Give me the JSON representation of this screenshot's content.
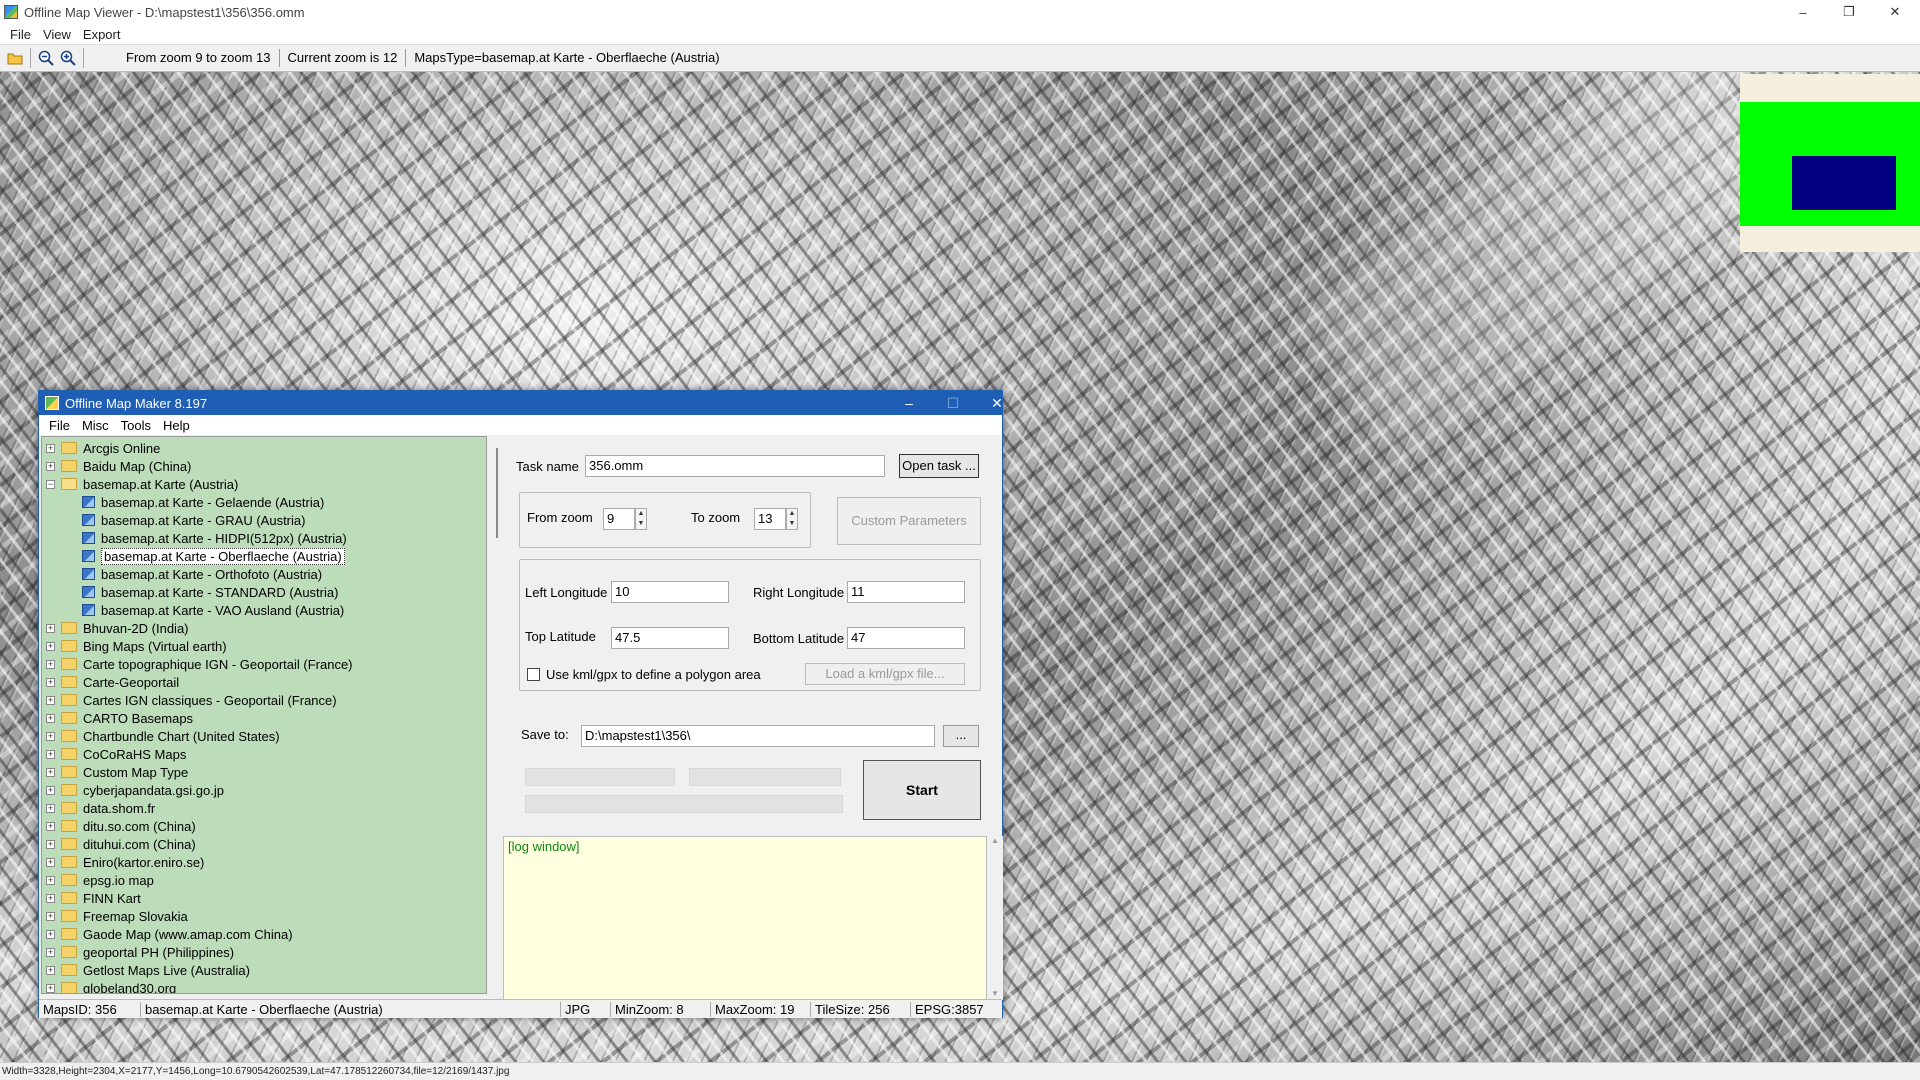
{
  "window": {
    "title": "Offline Map Viewer - D:\\mapstest1\\356\\356.omm",
    "controls": {
      "minimize": "–",
      "maximize": "❐",
      "close": "✕"
    }
  },
  "menu": [
    "File",
    "View",
    "Export"
  ],
  "toolbar": {
    "icons": [
      "open-folder-icon",
      "zoom-out-icon",
      "zoom-in-icon"
    ],
    "zoom_range": "From zoom 9 to zoom 13",
    "current_zoom": "Current zoom is 12",
    "maps_type": "MapsType=basemap.at Karte - Oberflaeche (Austria)"
  },
  "colors": {
    "minimap_bg": "#f5efe0",
    "minimap_green": "#00ff00",
    "minimap_view": "#000080",
    "tree_bg": "#bddcba",
    "dialog_title": "#1e5eb5",
    "log_bg": "#ffffe0",
    "log_text": "#118811"
  },
  "statusbar": "Width=3328,Height=2304,X=2177,Y=1456,Long=10.6790542602539,Lat=47.178512260734,file=12/2169/1437.jpg",
  "dialog": {
    "title": "Offline Map Maker 8.197",
    "controls": {
      "minimize": "–",
      "maximize": "☐",
      "close": "✕"
    },
    "menu": [
      "File",
      "Misc",
      "Tools",
      "Help"
    ],
    "tree": [
      {
        "label": "Arcgis Online",
        "type": "folder",
        "expander": "+"
      },
      {
        "label": "Baidu Map (China)",
        "type": "folder",
        "expander": "+"
      },
      {
        "label": "basemap.at Karte (Austria)",
        "type": "folder-open",
        "expander": "−"
      },
      {
        "label": "basemap.at Karte - Gelaende (Austria)",
        "type": "map"
      },
      {
        "label": "basemap.at Karte - GRAU (Austria)",
        "type": "map"
      },
      {
        "label": "basemap.at Karte - HIDPI(512px) (Austria)",
        "type": "map"
      },
      {
        "label": "basemap.at Karte - Oberflaeche (Austria)",
        "type": "map",
        "selected": true
      },
      {
        "label": "basemap.at Karte - Orthofoto (Austria)",
        "type": "map"
      },
      {
        "label": "basemap.at Karte - STANDARD (Austria)",
        "type": "map"
      },
      {
        "label": "basemap.at Karte - VAO Ausland (Austria)",
        "type": "map"
      },
      {
        "label": "Bhuvan-2D (India)",
        "type": "folder",
        "expander": "+"
      },
      {
        "label": "Bing Maps (Virtual earth)",
        "type": "folder",
        "expander": "+"
      },
      {
        "label": "Carte topographique IGN - Geoportail (France)",
        "type": "folder",
        "expander": "+"
      },
      {
        "label": "Carte-Geoportail",
        "type": "folder",
        "expander": "+"
      },
      {
        "label": "Cartes IGN classiques - Geoportail (France)",
        "type": "folder",
        "expander": "+"
      },
      {
        "label": "CARTO Basemaps",
        "type": "folder",
        "expander": "+"
      },
      {
        "label": "Chartbundle Chart (United States)",
        "type": "folder",
        "expander": "+"
      },
      {
        "label": "CoCoRaHS Maps",
        "type": "folder",
        "expander": "+"
      },
      {
        "label": "Custom Map Type",
        "type": "folder",
        "expander": "+"
      },
      {
        "label": "cyberjapandata.gsi.go.jp",
        "type": "folder",
        "expander": "+"
      },
      {
        "label": "data.shom.fr",
        "type": "folder",
        "expander": "+"
      },
      {
        "label": "ditu.so.com (China)",
        "type": "folder",
        "expander": "+"
      },
      {
        "label": "dituhui.com (China)",
        "type": "folder",
        "expander": "+"
      },
      {
        "label": "Eniro(kartor.eniro.se)",
        "type": "folder",
        "expander": "+"
      },
      {
        "label": "epsg.io map",
        "type": "folder",
        "expander": "+"
      },
      {
        "label": "FINN Kart",
        "type": "folder",
        "expander": "+"
      },
      {
        "label": "Freemap Slovakia",
        "type": "folder",
        "expander": "+"
      },
      {
        "label": "Gaode Map (www.amap.com China)",
        "type": "folder",
        "expander": "+"
      },
      {
        "label": "geoportal PH (Philippines)",
        "type": "folder",
        "expander": "+"
      },
      {
        "label": "Getlost Maps Live (Australia)",
        "type": "folder",
        "expander": "+"
      },
      {
        "label": "globeland30.org",
        "type": "folder",
        "expander": "+"
      }
    ],
    "task_name_label": "Task name",
    "task_name_value": "356.omm",
    "open_task_button": "Open task ...",
    "from_zoom_label": "From zoom",
    "from_zoom_value": "9",
    "to_zoom_label": "To zoom",
    "to_zoom_value": "13",
    "custom_params_button": "Custom Parameters",
    "left_lon_label": "Left Longitude",
    "left_lon_value": "10",
    "right_lon_label": "Right Longitude",
    "right_lon_value": "11",
    "top_lat_label": "Top Latitude",
    "top_lat_value": "47.5",
    "bottom_lat_label": "Bottom Latitude",
    "bottom_lat_value": "47",
    "kml_checkbox_label": "Use kml/gpx to define a polygon area",
    "kml_checked": false,
    "load_kml_button": "Load a kml/gpx file...",
    "save_to_label": "Save to:",
    "save_to_value": "D:\\mapstest1\\356\\",
    "browse_button": "...",
    "start_button": "Start",
    "log_text": "[log window]",
    "status": {
      "maps_id": "MapsID: 356",
      "map_name": "basemap.at Karte - Oberflaeche (Austria)",
      "format": "JPG",
      "min_zoom": "MinZoom: 8",
      "max_zoom": "MaxZoom: 19",
      "tile_size": "TileSize: 256",
      "epsg": "EPSG:3857"
    }
  }
}
